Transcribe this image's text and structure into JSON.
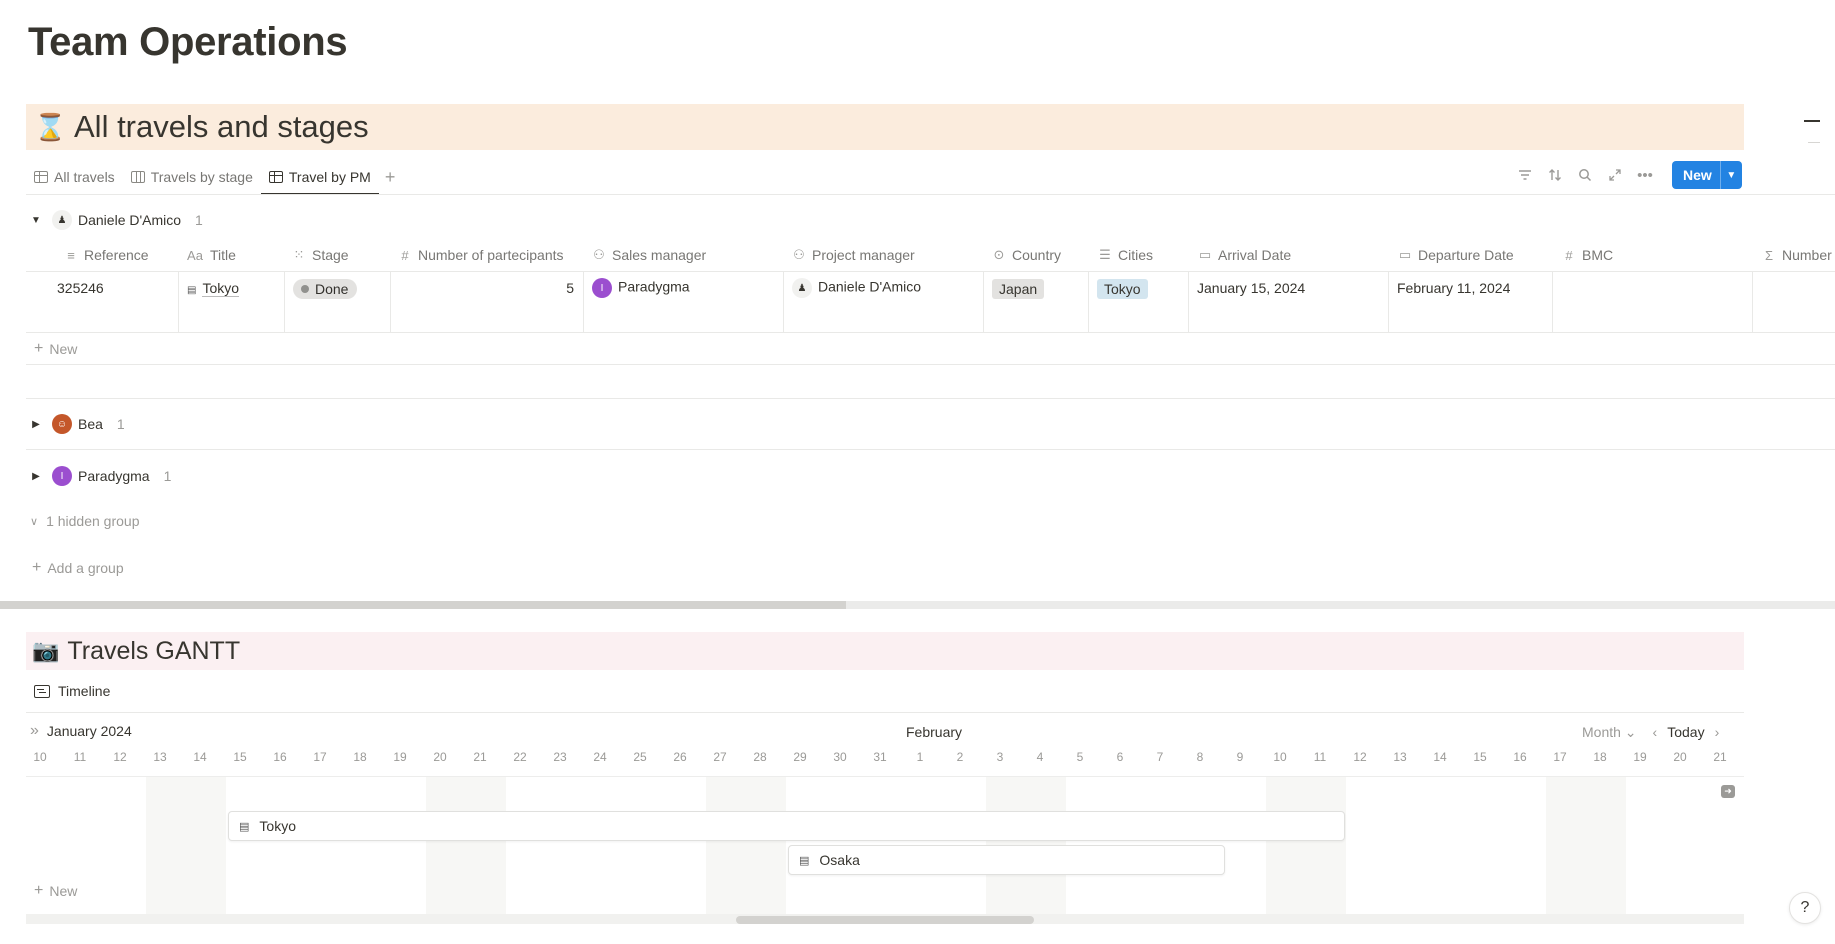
{
  "page": {
    "title": "Team Operations"
  },
  "section1": {
    "emoji": "⌛",
    "title": "All travels and stages",
    "tabs": [
      {
        "label": "All travels",
        "icon": "table-icon"
      },
      {
        "label": "Travels by stage",
        "icon": "board-icon"
      },
      {
        "label": "Travel by PM",
        "icon": "table-icon",
        "active": true
      }
    ],
    "toolbar": {
      "new_label": "New"
    },
    "groups": [
      {
        "name": "Daniele D'Amico",
        "count": "1",
        "expanded": true,
        "avatar_color": "#37352f"
      },
      {
        "name": "Bea",
        "count": "1",
        "expanded": false,
        "avatar_color": "#c4572a"
      },
      {
        "name": "Paradygma",
        "count": "1",
        "expanded": false,
        "avatar_color": "#9b4ecf",
        "avatar_letter": "I"
      }
    ],
    "columns": [
      {
        "label": "Reference",
        "icon": "≡"
      },
      {
        "label": "Title",
        "icon": "Aa"
      },
      {
        "label": "Stage",
        "icon": "⁙"
      },
      {
        "label": "Number of partecipants",
        "icon": "#"
      },
      {
        "label": "Sales manager",
        "icon": "👥"
      },
      {
        "label": "Project manager",
        "icon": "👥"
      },
      {
        "label": "Country",
        "icon": "▾"
      },
      {
        "label": "Cities",
        "icon": "☰"
      },
      {
        "label": "Arrival Date",
        "icon": "▭"
      },
      {
        "label": "Departure Date",
        "icon": "▭"
      },
      {
        "label": "BMC",
        "icon": "#"
      },
      {
        "label": "Number",
        "icon": "Σ"
      }
    ],
    "row": {
      "reference": "325246",
      "title": "Tokyo",
      "stage": "Done",
      "participants": "5",
      "sales_manager": "Paradygma",
      "sales_manager_letter": "I",
      "project_manager": "Daniele D'Amico",
      "country": "Japan",
      "city": "Tokyo",
      "arrival": "January 15, 2024",
      "departure": "February 11, 2024"
    },
    "new_row_label": "New",
    "hidden_group_label": "1 hidden group",
    "add_group_label": "Add a group"
  },
  "section2": {
    "emoji": "📷",
    "title": "Travels GANTT",
    "tab_label": "Timeline",
    "month_label": "January 2024",
    "feb_label": "February",
    "view_label": "Month",
    "today_label": "Today",
    "days": [
      "10",
      "11",
      "12",
      "13",
      "14",
      "15",
      "16",
      "17",
      "18",
      "19",
      "20",
      "21",
      "22",
      "23",
      "24",
      "25",
      "26",
      "27",
      "28",
      "29",
      "30",
      "31",
      "1",
      "2",
      "3",
      "4",
      "5",
      "6",
      "7",
      "8",
      "9",
      "10",
      "11",
      "12",
      "13",
      "14",
      "15",
      "16",
      "17",
      "18",
      "19",
      "20",
      "21"
    ],
    "bars": [
      {
        "label": "Tokyo"
      },
      {
        "label": "Osaka"
      }
    ],
    "new_label": "New"
  },
  "colors": {
    "accent": "#2383e2",
    "section1_bg": "#fbecdd",
    "section2_bg": "#fbf0f2"
  },
  "help_label": "?"
}
